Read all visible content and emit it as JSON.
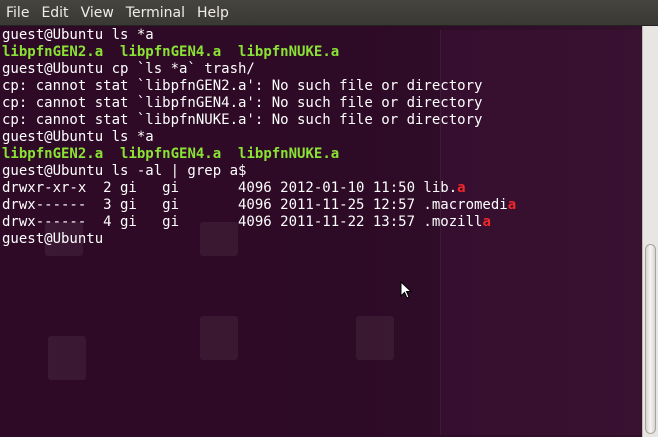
{
  "menu": {
    "items": [
      "File",
      "Edit",
      "View",
      "Terminal",
      "Help"
    ]
  },
  "terminal": {
    "lines": [
      [
        {
          "t": "guest@Ubuntu ls *a",
          "c": "w"
        }
      ],
      [
        {
          "t": "libpfnGEN2.a",
          "c": "g"
        },
        {
          "t": "  ",
          "c": "w"
        },
        {
          "t": "libpfnGEN4.a",
          "c": "g"
        },
        {
          "t": "  ",
          "c": "w"
        },
        {
          "t": "libpfnNUKE.a",
          "c": "g"
        }
      ],
      [
        {
          "t": "guest@Ubuntu cp `ls *a` trash/",
          "c": "w"
        }
      ],
      [
        {
          "t": "cp: cannot stat `libpfnGEN2.a': No such file or directory",
          "c": "w"
        }
      ],
      [
        {
          "t": "cp: cannot stat `libpfnGEN4.a': No such file or directory",
          "c": "w"
        }
      ],
      [
        {
          "t": "cp: cannot stat `libpfnNUKE.a': No such file or directory",
          "c": "w"
        }
      ],
      [
        {
          "t": "guest@Ubuntu ls *a",
          "c": "w"
        }
      ],
      [
        {
          "t": "libpfnGEN2.a",
          "c": "g"
        },
        {
          "t": "  ",
          "c": "w"
        },
        {
          "t": "libpfnGEN4.a",
          "c": "g"
        },
        {
          "t": "  ",
          "c": "w"
        },
        {
          "t": "libpfnNUKE.a",
          "c": "g"
        }
      ],
      [
        {
          "t": "guest@Ubuntu ls -al | grep a$",
          "c": "w"
        }
      ],
      [
        {
          "t": "drwxr-xr-x  2 gi   gi       4096 2012-01-10 11:50 lib.",
          "c": "w"
        },
        {
          "t": "a",
          "c": "r"
        }
      ],
      [
        {
          "t": "drwx------  3 gi   gi       4096 2011-11-25 12:57 .macromedi",
          "c": "w"
        },
        {
          "t": "a",
          "c": "r"
        }
      ],
      [
        {
          "t": "drwx------  4 gi   gi       4096 2011-11-22 13:57 .mozill",
          "c": "w"
        },
        {
          "t": "a",
          "c": "r"
        }
      ],
      [
        {
          "t": "guest@Ubuntu",
          "c": "w"
        }
      ]
    ]
  },
  "colors": {
    "background": "#2c0a24",
    "text": "#ffffff",
    "green": "#8ae234",
    "red": "#ef2929"
  }
}
